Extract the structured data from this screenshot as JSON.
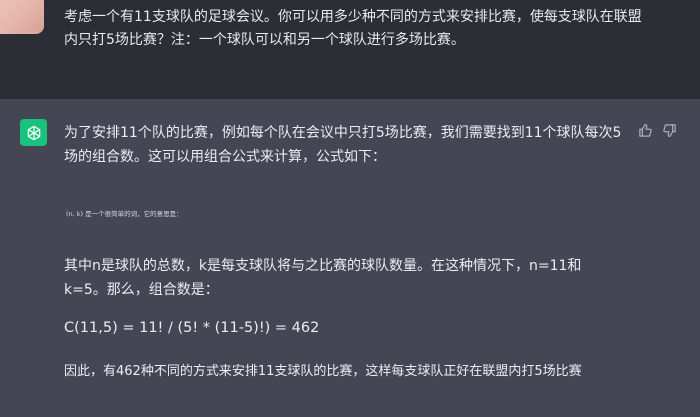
{
  "user_message": {
    "text": "考虑一个有11支球队的足球会议。你可以用多少种不同的方式来安排比赛，使每支球队在联盟内只打5场比赛？注：一个球队可以和另一个球队进行多场比赛。"
  },
  "assistant_message": {
    "paragraph_1": "为了安排11个队的比赛，例如每个队在会议中只打5场比赛，我们需要找到11个球队每次5场的组合数。这可以用组合公式来计算，公式如下：",
    "small_note": "(n, k) 是一个很简单的词，它的意思是：",
    "paragraph_2": "其中n是球队的总数，k是每支球队将与之比赛的球队数量。在这种情况下，n=11和k=5。那么，组合数是：",
    "formula": "C(11,5) = 11! / (5! * (11-5)!) = 462",
    "paragraph_3": "因此，有462种不同的方式来安排11支球队的比赛，这样每支球队正好在联盟内打5场比赛"
  },
  "icons": {
    "bot_avatar": "openai-logo-icon",
    "thumb_up": "thumbs-up-icon",
    "thumb_down": "thumbs-down-icon"
  },
  "colors": {
    "user_bg": "#2c2d35",
    "assistant_bg": "#444654",
    "bot_avatar_bg": "#19c37d",
    "text": "#ececf1"
  }
}
